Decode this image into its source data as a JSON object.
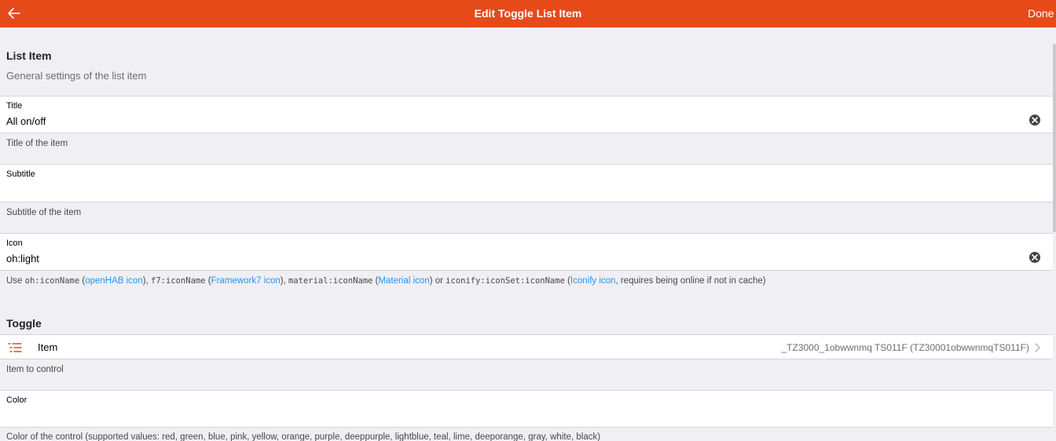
{
  "navbar": {
    "title": "Edit Toggle List Item",
    "done_label": "Done"
  },
  "list_item_block": {
    "title": "List Item",
    "description": "General settings of the list item"
  },
  "fields": {
    "title": {
      "label": "Title",
      "value": "All on/off",
      "info": "Title of the item"
    },
    "subtitle": {
      "label": "Subtitle",
      "value": "",
      "info": "Subtitle of the item"
    },
    "icon": {
      "label": "Icon",
      "value": "oh:light",
      "info": {
        "t1": "Use ",
        "c1": "oh:iconName",
        "t2": " (",
        "l1": "openHAB icon",
        "t3": "), ",
        "c2": "f7:iconName",
        "t4": " (",
        "l2": "Framework7 icon",
        "t5": "), ",
        "c3": "material:iconName",
        "t6": " (",
        "l3": "Material icon",
        "t7": ") or ",
        "c4": "iconify:iconSet:iconName",
        "t8": " (",
        "l4": "Iconify icon",
        "t9": ", requires being online if not in cache)"
      }
    },
    "color": {
      "label": "Color",
      "value": "",
      "info": "Color of the control (supported values: red, green, blue, pink, yellow, orange, purple, deeppurple, lightblue, teal, lime, deeporange, gray, white, black)"
    }
  },
  "toggle_block": {
    "title": "Toggle"
  },
  "item_picker": {
    "label": "Item",
    "value": "_TZ3000_1obwwnmq TS011F (TZ30001obwwnmqTS011F)",
    "info": "Item to control"
  },
  "colors": {
    "navbar": "#e64a19",
    "link": "#2196f3",
    "background": "#efeff4"
  },
  "icons": {
    "back": "arrow-left-icon",
    "clear": "clear-circle-icon",
    "item": "list-icon",
    "chevron": "chevron-right-icon"
  }
}
